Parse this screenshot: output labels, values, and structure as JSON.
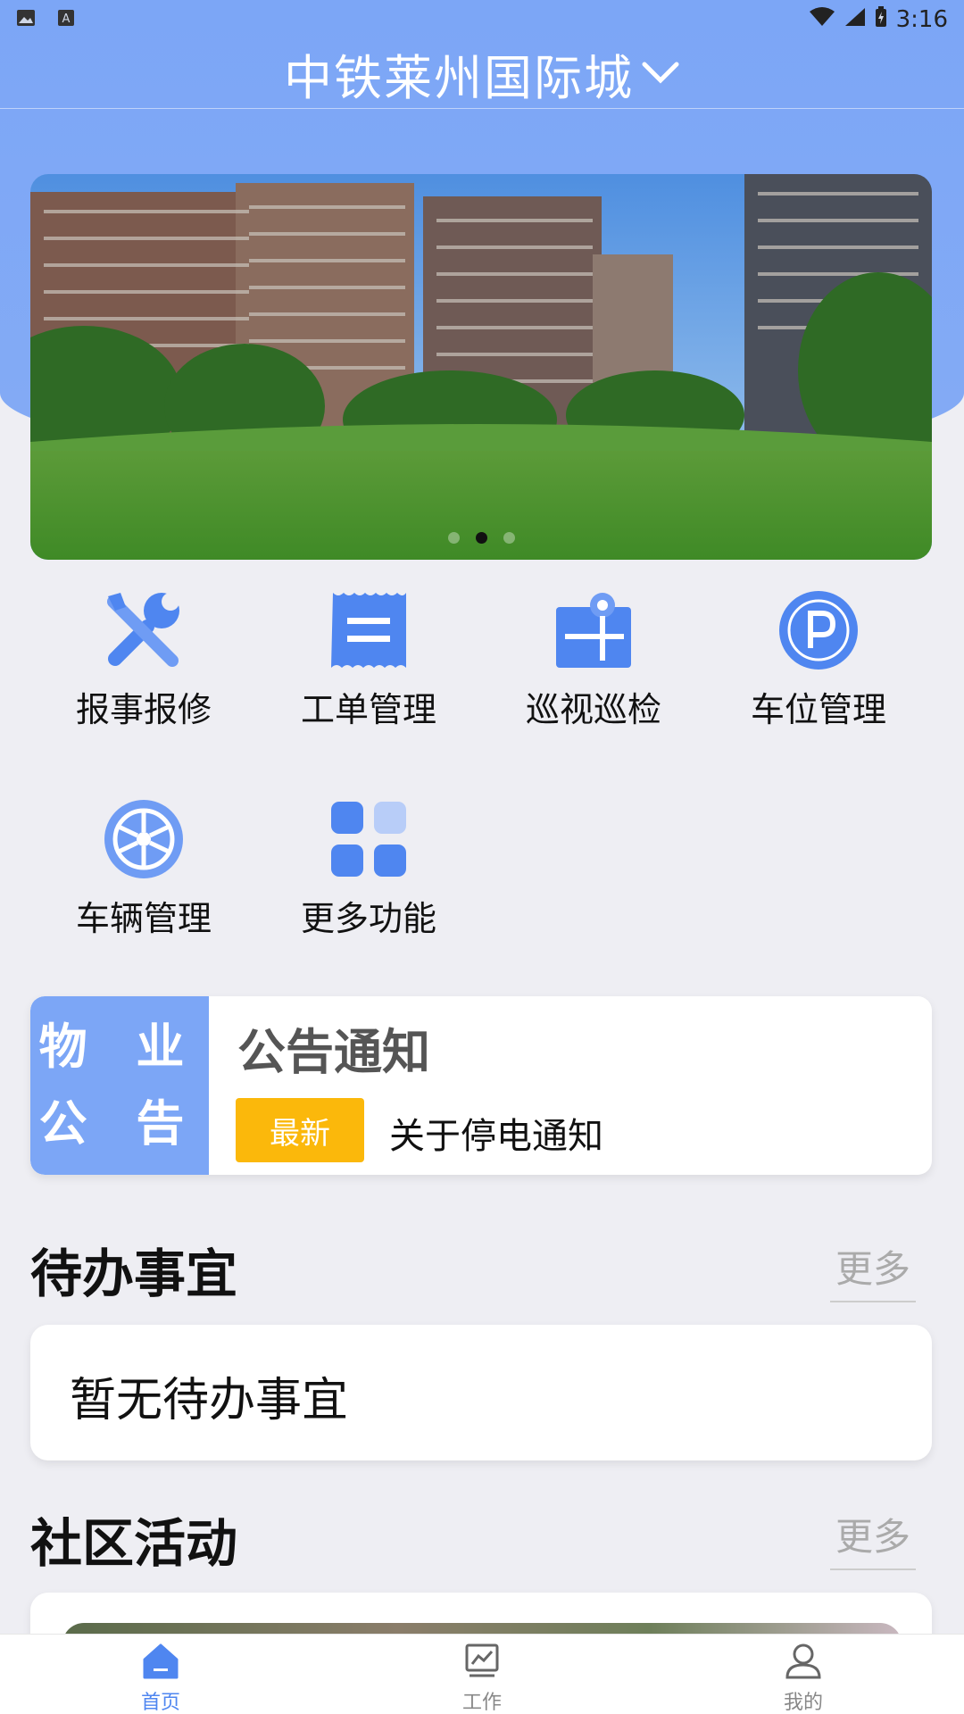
{
  "status_bar": {
    "time": "3:16",
    "icons": [
      "image-icon",
      "font-icon",
      "wifi-icon",
      "signal-icon",
      "battery-icon"
    ]
  },
  "header": {
    "title": "中铁莱州国际城",
    "dropdown_icon": "chevron-down-icon"
  },
  "banner": {
    "image": "residential-towers-lawn",
    "dot_count": 3,
    "active_dot": 2
  },
  "menu": {
    "items": [
      {
        "label": "报事报修",
        "icon": "repair-tools-icon"
      },
      {
        "label": "工单管理",
        "icon": "work-order-icon"
      },
      {
        "label": "巡视巡检",
        "icon": "inspection-icon"
      },
      {
        "label": "车位管理",
        "icon": "parking-icon"
      },
      {
        "label": "车辆管理",
        "icon": "wheel-icon"
      },
      {
        "label": "更多功能",
        "icon": "more-grid-icon"
      }
    ]
  },
  "notice": {
    "tag_line1": "物 业",
    "tag_line2": "公 告",
    "title": "公告通知",
    "badge": "最新",
    "text": "关于停电通知"
  },
  "todo": {
    "title": "待办事宜",
    "more": "更多",
    "empty_text": "暂无待办事宜"
  },
  "community": {
    "title": "社区活动",
    "more": "更多"
  },
  "tabbar": {
    "tabs": [
      {
        "label": "首页",
        "icon": "home-icon",
        "active": true
      },
      {
        "label": "工作",
        "icon": "chart-board-icon",
        "active": false
      },
      {
        "label": "我的",
        "icon": "user-icon",
        "active": false
      }
    ]
  },
  "colors": {
    "primary": "#7ca6f6",
    "icon_blue": "#4f86f0",
    "badge": "#fbb80b"
  }
}
